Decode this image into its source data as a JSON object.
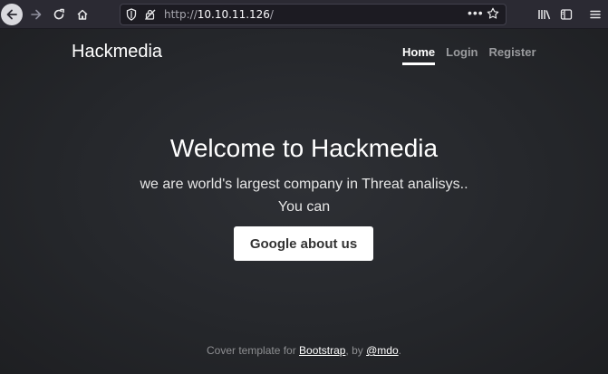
{
  "browser": {
    "url_scheme": "http://",
    "url_host": "10.10.11.126",
    "url_path": "/",
    "overflow_menu": "•••"
  },
  "site": {
    "brand": "Hackmedia",
    "nav": [
      {
        "label": "Home",
        "active": true
      },
      {
        "label": "Login",
        "active": false
      },
      {
        "label": "Register",
        "active": false
      }
    ],
    "hero": {
      "title": "Welcome to Hackmedia",
      "line1": "we are world's largest company in Threat analisys..",
      "line2": "You can",
      "button_label": "Google about us"
    },
    "footer": {
      "prefix": "Cover template for ",
      "link1": "Bootstrap",
      "middle": ", by ",
      "link2": "@mdo",
      "suffix": "."
    }
  },
  "colors": {
    "page_background": "#25272b",
    "toolbar_background": "#2b2a33",
    "button_background": "#ffffff"
  }
}
